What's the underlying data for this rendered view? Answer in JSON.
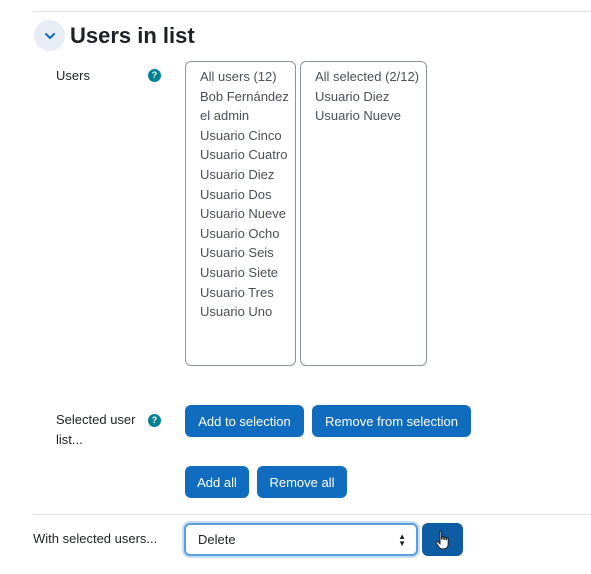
{
  "section": {
    "title": "Users in list"
  },
  "users_field": {
    "label": "Users",
    "available": [
      "All users (12)",
      "Bob Fernández",
      "el admin",
      "Usuario Cinco",
      "Usuario Cuatro",
      "Usuario Diez",
      "Usuario Dos",
      "Usuario Nueve",
      "Usuario Ocho",
      "Usuario Seis",
      "Usuario Siete",
      "Usuario Tres",
      "Usuario Uno"
    ],
    "selected": [
      "All selected (2/12)",
      "Usuario Diez",
      "Usuario Nueve"
    ]
  },
  "selection_field": {
    "label_line1": "Selected user",
    "label_line2": "list...",
    "add_to_selection": "Add to selection",
    "remove_from_selection": "Remove from selection",
    "add_all": "Add all",
    "remove_all": "Remove all"
  },
  "bulk_action": {
    "label": "With selected users...",
    "selected_value": "Delete"
  },
  "icons": {
    "collapse": "chevron-down-icon",
    "help": "question-circle-icon",
    "go": "cursor-hand-icon"
  },
  "colors": {
    "primary": "#0f6cbf",
    "help": "#008196"
  }
}
